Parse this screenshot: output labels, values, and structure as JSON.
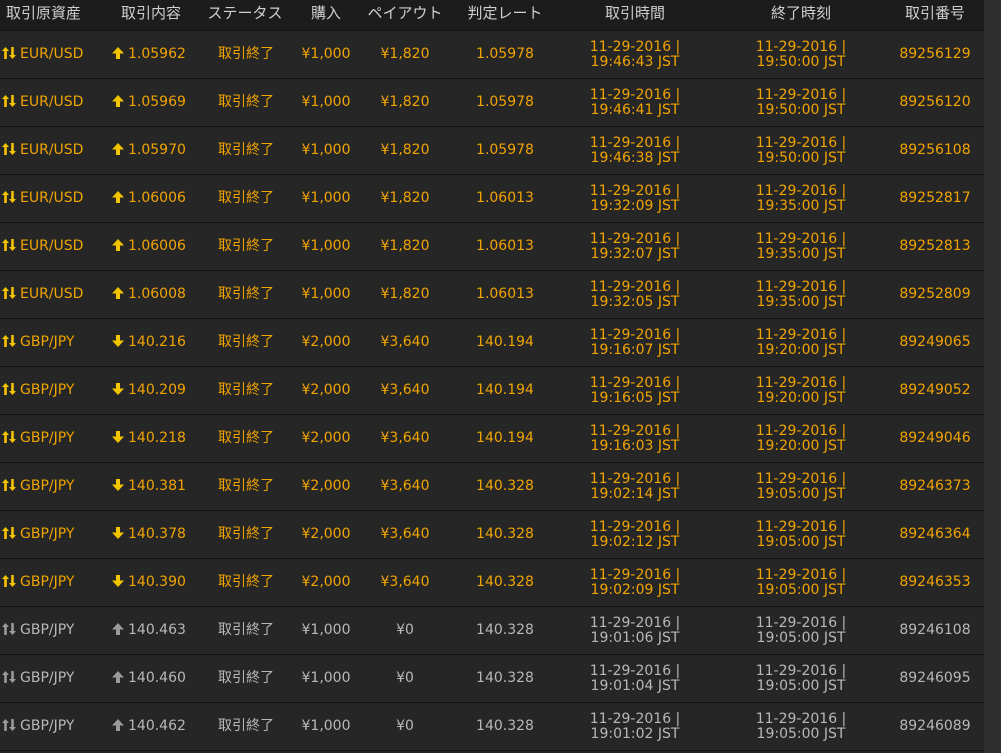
{
  "header": {
    "asset": "取引原資産",
    "direction": "取引内容",
    "status": "ステータス",
    "buy": "購入",
    "payout": "ペイアウト",
    "rate": "判定レート",
    "trade_time": "取引時間",
    "end_time": "終了時刻",
    "trade_no": "取引番号"
  },
  "rows": [
    {
      "asset": "EUR/USD",
      "direction": "up",
      "entry": "1.05962",
      "status": "取引終了",
      "buy": "¥1,000",
      "payout": "¥1,820",
      "rate": "1.05978",
      "trade_date": "11-29-2016 |",
      "trade_clock": "19:46:43 JST",
      "end_date": "11-29-2016 |",
      "end_clock": "19:50:00 JST",
      "trade_no": "89256129",
      "active": true
    },
    {
      "asset": "EUR/USD",
      "direction": "up",
      "entry": "1.05969",
      "status": "取引終了",
      "buy": "¥1,000",
      "payout": "¥1,820",
      "rate": "1.05978",
      "trade_date": "11-29-2016 |",
      "trade_clock": "19:46:41 JST",
      "end_date": "11-29-2016 |",
      "end_clock": "19:50:00 JST",
      "trade_no": "89256120",
      "active": true
    },
    {
      "asset": "EUR/USD",
      "direction": "up",
      "entry": "1.05970",
      "status": "取引終了",
      "buy": "¥1,000",
      "payout": "¥1,820",
      "rate": "1.05978",
      "trade_date": "11-29-2016 |",
      "trade_clock": "19:46:38 JST",
      "end_date": "11-29-2016 |",
      "end_clock": "19:50:00 JST",
      "trade_no": "89256108",
      "active": true
    },
    {
      "asset": "EUR/USD",
      "direction": "up",
      "entry": "1.06006",
      "status": "取引終了",
      "buy": "¥1,000",
      "payout": "¥1,820",
      "rate": "1.06013",
      "trade_date": "11-29-2016 |",
      "trade_clock": "19:32:09 JST",
      "end_date": "11-29-2016 |",
      "end_clock": "19:35:00 JST",
      "trade_no": "89252817",
      "active": true
    },
    {
      "asset": "EUR/USD",
      "direction": "up",
      "entry": "1.06006",
      "status": "取引終了",
      "buy": "¥1,000",
      "payout": "¥1,820",
      "rate": "1.06013",
      "trade_date": "11-29-2016 |",
      "trade_clock": "19:32:07 JST",
      "end_date": "11-29-2016 |",
      "end_clock": "19:35:00 JST",
      "trade_no": "89252813",
      "active": true
    },
    {
      "asset": "EUR/USD",
      "direction": "up",
      "entry": "1.06008",
      "status": "取引終了",
      "buy": "¥1,000",
      "payout": "¥1,820",
      "rate": "1.06013",
      "trade_date": "11-29-2016 |",
      "trade_clock": "19:32:05 JST",
      "end_date": "11-29-2016 |",
      "end_clock": "19:35:00 JST",
      "trade_no": "89252809",
      "active": true
    },
    {
      "asset": "GBP/JPY",
      "direction": "down",
      "entry": "140.216",
      "status": "取引終了",
      "buy": "¥2,000",
      "payout": "¥3,640",
      "rate": "140.194",
      "trade_date": "11-29-2016 |",
      "trade_clock": "19:16:07 JST",
      "end_date": "11-29-2016 |",
      "end_clock": "19:20:00 JST",
      "trade_no": "89249065",
      "active": true
    },
    {
      "asset": "GBP/JPY",
      "direction": "down",
      "entry": "140.209",
      "status": "取引終了",
      "buy": "¥2,000",
      "payout": "¥3,640",
      "rate": "140.194",
      "trade_date": "11-29-2016 |",
      "trade_clock": "19:16:05 JST",
      "end_date": "11-29-2016 |",
      "end_clock": "19:20:00 JST",
      "trade_no": "89249052",
      "active": true
    },
    {
      "asset": "GBP/JPY",
      "direction": "down",
      "entry": "140.218",
      "status": "取引終了",
      "buy": "¥2,000",
      "payout": "¥3,640",
      "rate": "140.194",
      "trade_date": "11-29-2016 |",
      "trade_clock": "19:16:03 JST",
      "end_date": "11-29-2016 |",
      "end_clock": "19:20:00 JST",
      "trade_no": "89249046",
      "active": true
    },
    {
      "asset": "GBP/JPY",
      "direction": "down",
      "entry": "140.381",
      "status": "取引終了",
      "buy": "¥2,000",
      "payout": "¥3,640",
      "rate": "140.328",
      "trade_date": "11-29-2016 |",
      "trade_clock": "19:02:14 JST",
      "end_date": "11-29-2016 |",
      "end_clock": "19:05:00 JST",
      "trade_no": "89246373",
      "active": true
    },
    {
      "asset": "GBP/JPY",
      "direction": "down",
      "entry": "140.378",
      "status": "取引終了",
      "buy": "¥2,000",
      "payout": "¥3,640",
      "rate": "140.328",
      "trade_date": "11-29-2016 |",
      "trade_clock": "19:02:12 JST",
      "end_date": "11-29-2016 |",
      "end_clock": "19:05:00 JST",
      "trade_no": "89246364",
      "active": true
    },
    {
      "asset": "GBP/JPY",
      "direction": "down",
      "entry": "140.390",
      "status": "取引終了",
      "buy": "¥2,000",
      "payout": "¥3,640",
      "rate": "140.328",
      "trade_date": "11-29-2016 |",
      "trade_clock": "19:02:09 JST",
      "end_date": "11-29-2016 |",
      "end_clock": "19:05:00 JST",
      "trade_no": "89246353",
      "active": true
    },
    {
      "asset": "GBP/JPY",
      "direction": "up",
      "entry": "140.463",
      "status": "取引終了",
      "buy": "¥1,000",
      "payout": "¥0",
      "rate": "140.328",
      "trade_date": "11-29-2016 |",
      "trade_clock": "19:01:06 JST",
      "end_date": "11-29-2016 |",
      "end_clock": "19:05:00 JST",
      "trade_no": "89246108",
      "active": false
    },
    {
      "asset": "GBP/JPY",
      "direction": "up",
      "entry": "140.460",
      "status": "取引終了",
      "buy": "¥1,000",
      "payout": "¥0",
      "rate": "140.328",
      "trade_date": "11-29-2016 |",
      "trade_clock": "19:01:04 JST",
      "end_date": "11-29-2016 |",
      "end_clock": "19:05:00 JST",
      "trade_no": "89246095",
      "active": false
    },
    {
      "asset": "GBP/JPY",
      "direction": "up",
      "entry": "140.462",
      "status": "取引終了",
      "buy": "¥1,000",
      "payout": "¥0",
      "rate": "140.328",
      "trade_date": "11-29-2016 |",
      "trade_clock": "19:01:02 JST",
      "end_date": "11-29-2016 |",
      "end_clock": "19:05:00 JST",
      "trade_no": "89246089",
      "active": false
    }
  ],
  "icons": {
    "asset": "swap-vertical-icon",
    "up": "arrow-up-icon",
    "down": "arrow-down-icon"
  },
  "colors": {
    "background": "#262626",
    "header_background": "#1c1c1c",
    "active_text": "#f0a400",
    "inactive_text": "#b8b8b8",
    "header_text": "#cfcfcf",
    "active_arrow": "#f5c400",
    "inactive_arrow": "#9a9a9a"
  }
}
